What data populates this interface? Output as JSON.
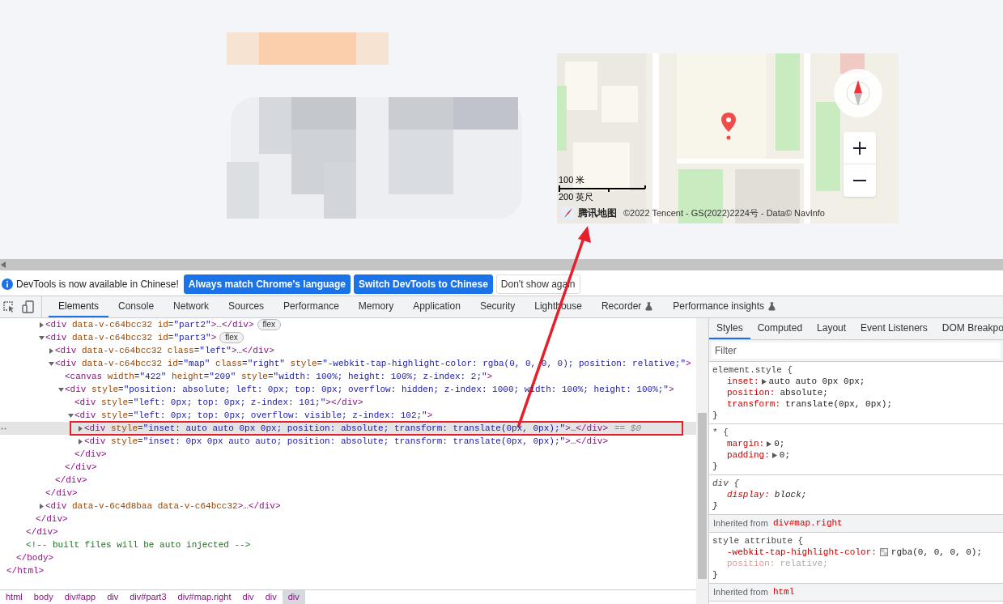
{
  "map": {
    "scale_metric": "100 米",
    "scale_imperial": "200 英尺",
    "brand": "腾讯地图",
    "copyright": "©2022 Tencent - GS(2022)2224号 - Data© NavInfo"
  },
  "infobar": {
    "message": "DevTools is now available in Chinese!",
    "buttons": [
      {
        "label": "Always match Chrome's language",
        "kind": "primary"
      },
      {
        "label": "Switch DevTools to Chinese",
        "kind": "primary"
      },
      {
        "label": "Don't show again",
        "kind": "secondary"
      }
    ]
  },
  "panel_tabs": [
    {
      "label": "Elements",
      "selected": true,
      "experimental": false
    },
    {
      "label": "Console",
      "selected": false,
      "experimental": false
    },
    {
      "label": "Network",
      "selected": false,
      "experimental": false
    },
    {
      "label": "Sources",
      "selected": false,
      "experimental": false
    },
    {
      "label": "Performance",
      "selected": false,
      "experimental": false
    },
    {
      "label": "Memory",
      "selected": false,
      "experimental": false
    },
    {
      "label": "Application",
      "selected": false,
      "experimental": false
    },
    {
      "label": "Security",
      "selected": false,
      "experimental": false
    },
    {
      "label": "Lighthouse",
      "selected": false,
      "experimental": false
    },
    {
      "label": "Recorder",
      "selected": false,
      "experimental": true
    },
    {
      "label": "Performance insights",
      "selected": false,
      "experimental": true
    }
  ],
  "dom_tree": [
    {
      "selected": false,
      "close": "</html>",
      "children": [
        {
          "selected": false,
          "close": "</body>",
          "children": [
            {
              "selected": false,
              "close": "</div>",
              "children": [
                {
                  "selected": false,
                  "close": "</div>",
                  "children": [
                    {
                      "selected": false,
                      "open": "<div data-v-c64bcc32 id=\"part2\">…</div>",
                      "badge": "flex",
                      "expanded": false
                    },
                    {
                      "selected": false,
                      "open": "<div data-v-c64bcc32 id=\"part3\">",
                      "badge": "flex",
                      "expanded": true,
                      "close": "</div>",
                      "children": [
                        {
                          "selected": false,
                          "open": "<div data-v-c64bcc32 class=\"left\">…</div>",
                          "expanded": false
                        },
                        {
                          "selected": false,
                          "open": "<div data-v-c64bcc32 id=\"map\" class=\"right\" style=\"-webkit-tap-highlight-color: rgba(0, 0, 0, 0); position: relative;\">",
                          "expanded": true,
                          "close": "</div>",
                          "children": [
                            {
                              "selected": false,
                              "open": "<canvas width=\"422\" height=\"209\" style=\"width: 100%; height: 100%; z-index: 2;\">"
                            },
                            {
                              "selected": false,
                              "open": "<div style=\"position: absolute; left: 0px; top: 0px; overflow: hidden; z-index: 1000; width: 100%; height: 100%;\">",
                              "expanded": true,
                              "close": "</div>",
                              "children": [
                                {
                                  "selected": false,
                                  "open": "<div style=\"left: 0px; top: 0px; z-index: 101;\"></div>"
                                },
                                {
                                  "selected": false,
                                  "open": "<div style=\"left: 0px; top: 0px; overflow: visible; z-index: 102;\">",
                                  "expanded": true,
                                  "close": "</div>",
                                  "children": [
                                    {
                                      "selected": true,
                                      "open": "<div style=\"inset: auto auto 0px 0px; position: absolute; transform: translate(0px, 0px);\">…</div>",
                                      "expanded": false,
                                      "console_ref": "== $0"
                                    },
                                    {
                                      "selected": false,
                                      "open": "<div style=\"inset: 0px 0px auto auto; position: absolute; transform: translate(0px, 0px);\">…</div>",
                                      "expanded": false
                                    }
                                  ]
                                }
                              ]
                            }
                          ]
                        }
                      ]
                    },
                    {
                      "selected": false,
                      "open": "<div data-v-6c4d8baa data-v-c64bcc32>…</div>",
                      "expanded": false
                    }
                  ]
                }
              ]
            },
            {
              "selected": false,
              "open": "<!-- built files will be auto injected -->"
            }
          ]
        }
      ]
    }
  ],
  "breadcrumbs": [
    {
      "label": "html",
      "selected": false
    },
    {
      "label": "body",
      "selected": false
    },
    {
      "label": "div#app",
      "selected": false
    },
    {
      "label": "div",
      "selected": false
    },
    {
      "label": "div#part3",
      "selected": false
    },
    {
      "label": "div#map.right",
      "selected": false
    },
    {
      "label": "div",
      "selected": false
    },
    {
      "label": "div",
      "selected": false
    },
    {
      "label": "div",
      "selected": true
    }
  ],
  "side_tabs": [
    {
      "label": "Styles",
      "selected": true
    },
    {
      "label": "Computed",
      "selected": false
    },
    {
      "label": "Layout",
      "selected": false
    },
    {
      "label": "Event Listeners",
      "selected": false
    },
    {
      "label": "DOM Breakpo",
      "selected": false
    }
  ],
  "filter": {
    "placeholder": "Filter"
  },
  "style_sections": [
    {
      "kind": "rule",
      "selector": "element.style {",
      "user_agent": false,
      "close": "}",
      "properties": [
        {
          "name": "inset:",
          "value": "auto auto 0px 0px;",
          "kind": "expandable",
          "overridden": false
        },
        {
          "name": "position:",
          "value": "absolute;",
          "kind": "plain",
          "overridden": false
        },
        {
          "name": "transform:",
          "value": "translate(0px, 0px);",
          "kind": "plain",
          "overridden": false
        }
      ]
    },
    {
      "kind": "rule",
      "selector": "* {",
      "user_agent": false,
      "close": "}",
      "properties": [
        {
          "name": "margin:",
          "value": "0;",
          "kind": "expandable",
          "overridden": false
        },
        {
          "name": "padding:",
          "value": "0;",
          "kind": "expandable",
          "overridden": false
        }
      ]
    },
    {
      "kind": "rule",
      "selector": "div {",
      "user_agent": true,
      "close": "}",
      "properties": [
        {
          "name": "display:",
          "value": "block;",
          "kind": "plain",
          "overridden": false
        }
      ]
    },
    {
      "kind": "inherited",
      "label": "Inherited from",
      "source": "div#map.right"
    },
    {
      "kind": "rule",
      "selector": "style attribute {",
      "user_agent": false,
      "close": "}",
      "properties": [
        {
          "name": "-webkit-tap-highlight-color:",
          "value": "rgba(0, 0, 0, 0);",
          "kind": "color",
          "overridden": false
        },
        {
          "name": "position:",
          "value": "relative;",
          "kind": "plain",
          "overridden": true
        }
      ]
    },
    {
      "kind": "inherited",
      "label": "Inherited from",
      "source": "html"
    }
  ]
}
